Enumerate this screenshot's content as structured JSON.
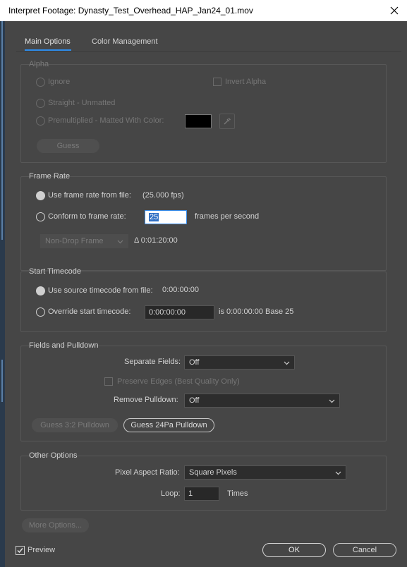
{
  "window": {
    "title": "Interpret Footage: Dynasty_Test_Overhead_HAP_Jan24_01.mov"
  },
  "tabs": [
    {
      "label": "Main Options"
    },
    {
      "label": "Color Management"
    }
  ],
  "alpha": {
    "title": "Alpha",
    "ignore": "Ignore",
    "invert_alpha": "Invert Alpha",
    "straight": "Straight - Unmatted",
    "premultiplied": "Premultiplied - Matted With Color:",
    "matte_color": "#000000",
    "guess": "Guess"
  },
  "frame_rate": {
    "title": "Frame Rate",
    "use_from_file": "Use frame rate from file:",
    "file_fps": "(25.000 fps)",
    "conform": "Conform to frame rate:",
    "conform_value": "25",
    "fps_label": "frames per second",
    "drop_frame": "Non-Drop Frame",
    "duration": "Δ 0:01:20:00"
  },
  "start_timecode": {
    "title": "Start Timecode",
    "use_source": "Use source timecode from file:",
    "source_value": "0:00:00:00",
    "override": "Override start timecode:",
    "override_value": "0:00:00:00",
    "is_value": "is 0:00:00:00",
    "base": "Base 25"
  },
  "fields": {
    "title": "Fields and Pulldown",
    "separate_label": "Separate Fields:",
    "separate_value": "Off",
    "preserve_edges": "Preserve Edges (Best Quality Only)",
    "remove_label": "Remove Pulldown:",
    "remove_value": "Off",
    "guess32": "Guess 3:2 Pulldown",
    "guess24": "Guess 24Pa Pulldown"
  },
  "other": {
    "title": "Other Options",
    "par_label": "Pixel Aspect Ratio:",
    "par_value": "Square Pixels",
    "loop_label": "Loop:",
    "loop_value": "1",
    "times": "Times"
  },
  "footer": {
    "more_options": "More Options...",
    "preview": "Preview",
    "ok": "OK",
    "cancel": "Cancel"
  },
  "colors": {
    "accent": "#2d8ceb",
    "panel_bg": "#464646"
  }
}
